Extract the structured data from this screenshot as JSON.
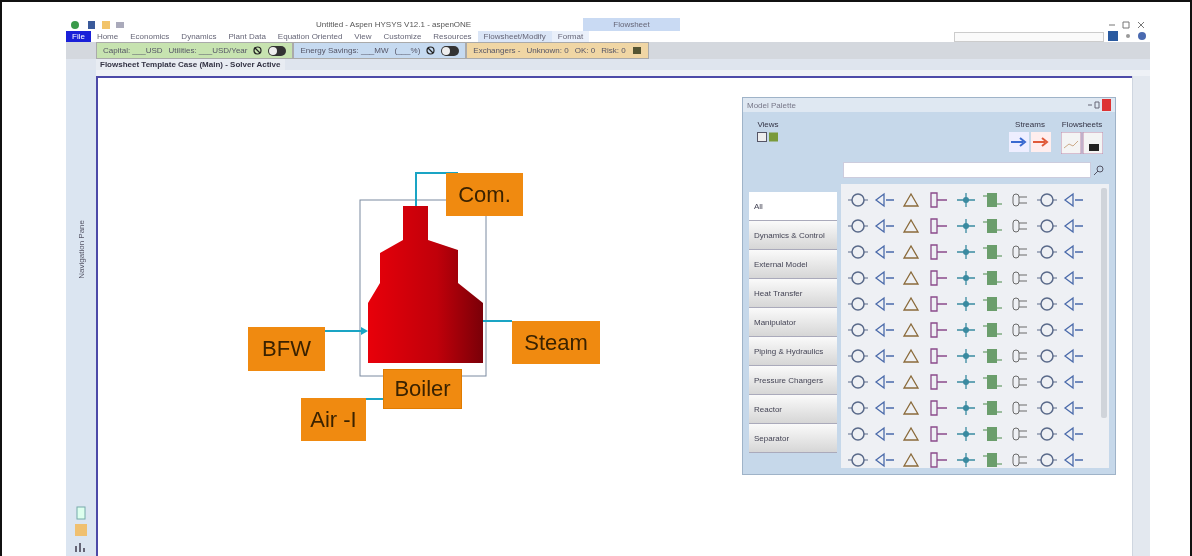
{
  "window": {
    "title": "Untitled - Aspen HYSYS V12.1 - aspenONE",
    "context_header": "Flowsheet"
  },
  "ribbon_tabs": [
    {
      "label": "File",
      "kind": "file",
      "selected": false
    },
    {
      "label": "Home",
      "kind": "tab",
      "selected": false
    },
    {
      "label": "Economics",
      "kind": "tab",
      "selected": false
    },
    {
      "label": "Dynamics",
      "kind": "tab",
      "selected": false
    },
    {
      "label": "Plant Data",
      "kind": "tab",
      "selected": false
    },
    {
      "label": "Equation Oriented",
      "kind": "tab",
      "selected": false
    },
    {
      "label": "View",
      "kind": "tab",
      "selected": false
    },
    {
      "label": "Customize",
      "kind": "tab",
      "selected": false
    },
    {
      "label": "Resources",
      "kind": "tab",
      "selected": false
    },
    {
      "label": "Flowsheet/Modify",
      "kind": "context",
      "selected": true
    },
    {
      "label": "Format",
      "kind": "context",
      "selected": false
    }
  ],
  "analysis_bar": {
    "groups": [
      {
        "kind": "green",
        "texts": [
          "Capital: ___USD",
          "Utilities: ___USD/Year"
        ],
        "toggle": {
          "on": false
        }
      },
      {
        "kind": "blue",
        "texts": [
          "Energy Savings: ___MW",
          "(___%)"
        ],
        "toggle": {
          "on": false
        }
      },
      {
        "kind": "orange",
        "texts": [
          "Exchangers -",
          "Unknown: 0",
          "OK: 0",
          "Risk: 0"
        ]
      }
    ]
  },
  "document_tab": {
    "label": "Flowsheet Template Case (Main) - Solver Active"
  },
  "navigation_pane": {
    "label": "Navigation Pane"
  },
  "flowsheet": {
    "labels": [
      {
        "kind": "stream",
        "text": "Com."
      },
      {
        "kind": "stream",
        "text": "BFW"
      },
      {
        "kind": "stream",
        "text": "Steam"
      },
      {
        "kind": "unit",
        "text": "Boiler"
      },
      {
        "kind": "stream",
        "text": "Air -I"
      }
    ]
  },
  "palette": {
    "title": "Model Palette",
    "views_label": "Views",
    "streams_label": "Streams",
    "flowsheets_label": "Flowsheets",
    "categories": [
      {
        "label": "All",
        "selected": true
      },
      {
        "label": "Dynamics & Control",
        "selected": false
      },
      {
        "label": "External Model",
        "selected": false
      },
      {
        "label": "Heat Transfer",
        "selected": false
      },
      {
        "label": "Manipulator",
        "selected": false
      },
      {
        "label": "Piping & Hydraulics",
        "selected": false
      },
      {
        "label": "Pressure Changers",
        "selected": false
      },
      {
        "label": "Reactor",
        "selected": false
      },
      {
        "label": "Separator",
        "selected": false
      }
    ]
  }
}
